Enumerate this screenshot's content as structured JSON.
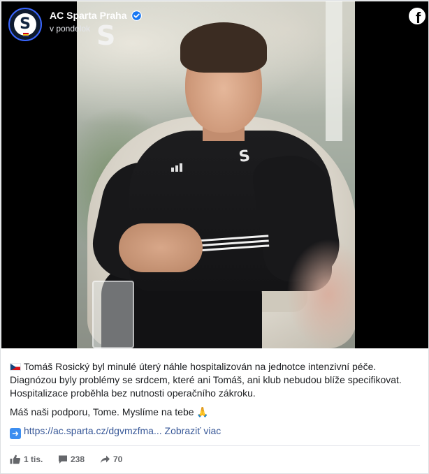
{
  "post": {
    "page_name": "AC Sparta Praha",
    "timestamp": "v pondelok",
    "verified": true,
    "avatar_letter": "S",
    "brand_watermark": "S",
    "text_line_1": "Tomáš Rosický byl minulé úterý náhle hospitalizován na jednotce intenzivní péče.",
    "text_line_2": "Diagnózou byly problémy se srdcem, které ani Tomáš, ani klub nebudou blíže specifikovat.",
    "text_line_3": "Hospitalizace proběhla bez nutnosti operačního zákroku.",
    "text_support": "Máš naši podporu, Tome. Myslíme na tebe 🙏",
    "link_text": "https://ac.sparta.cz/dgvmzfma...",
    "see_more": "Zobraziť viac",
    "icons": {
      "flag": "czech-flag-icon",
      "arrow": "arrow-right-icon",
      "platform": "facebook-icon"
    }
  },
  "engagement": {
    "likes": "1 tis.",
    "comments": "238",
    "shares": "70"
  },
  "colors": {
    "link": "#385898",
    "media_background": "#000000",
    "meta_gray": "#65676b",
    "verified_badge": "#1877f2"
  }
}
